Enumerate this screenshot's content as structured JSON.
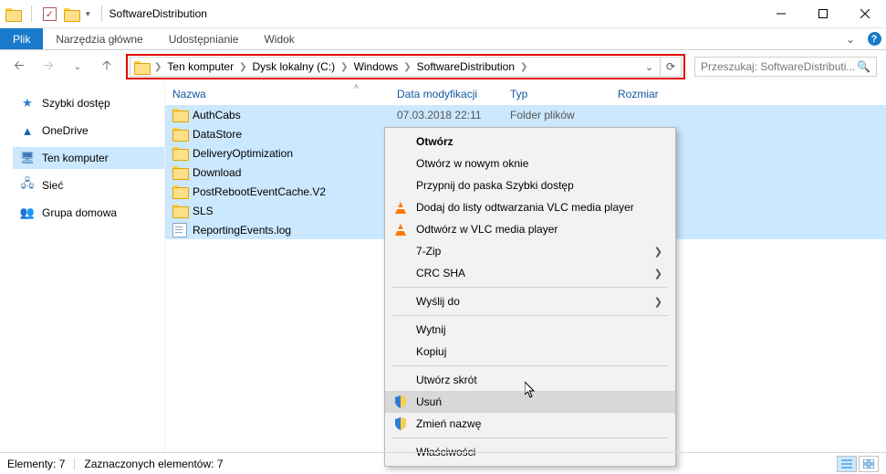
{
  "window": {
    "title": "SoftwareDistribution"
  },
  "ribbon": {
    "file": "Plik",
    "tabs": [
      "Narzędzia główne",
      "Udostępnianie",
      "Widok"
    ]
  },
  "breadcrumb": [
    "Ten komputer",
    "Dysk lokalny (C:)",
    "Windows",
    "SoftwareDistribution"
  ],
  "search": {
    "placeholder": "Przeszukaj: SoftwareDistributi..."
  },
  "navpane": {
    "items": [
      {
        "label": "Szybki dostęp",
        "icon": "star"
      },
      {
        "label": "OneDrive",
        "icon": "cloud"
      },
      {
        "label": "Ten komputer",
        "icon": "monitor",
        "selected": true
      },
      {
        "label": "Sieć",
        "icon": "net"
      },
      {
        "label": "Grupa domowa",
        "icon": "group"
      }
    ]
  },
  "columns": {
    "name": "Nazwa",
    "date": "Data modyfikacji",
    "type": "Typ",
    "size": "Rozmiar"
  },
  "rows": [
    {
      "name": "AuthCabs",
      "date": "07.03.2018 22:11",
      "type": "Folder plików",
      "kind": "folder",
      "selected": true
    },
    {
      "name": "DataStore",
      "date": "",
      "type": "",
      "kind": "folder",
      "selected": true
    },
    {
      "name": "DeliveryOptimization",
      "date": "",
      "type": "",
      "kind": "folder",
      "selected": true
    },
    {
      "name": "Download",
      "date": "",
      "type": "",
      "kind": "folder",
      "selected": true
    },
    {
      "name": "PostRebootEventCache.V2",
      "date": "",
      "type": "",
      "kind": "folder",
      "selected": true
    },
    {
      "name": "SLS",
      "date": "",
      "type": "",
      "kind": "folder",
      "selected": true
    },
    {
      "name": "ReportingEvents.log",
      "date": "",
      "type": "",
      "kind": "file",
      "selected": true
    }
  ],
  "context_menu": [
    {
      "label": "Otwórz",
      "bold": true
    },
    {
      "label": "Otwórz w nowym oknie"
    },
    {
      "label": "Przypnij do paska Szybki dostęp"
    },
    {
      "label": "Dodaj do listy odtwarzania VLC media player",
      "icon": "vlc"
    },
    {
      "label": "Odtwórz w VLC media player",
      "icon": "vlc"
    },
    {
      "label": "7-Zip",
      "submenu": true
    },
    {
      "label": "CRC SHA",
      "submenu": true
    },
    {
      "sep": true
    },
    {
      "label": "Wyślij do",
      "submenu": true
    },
    {
      "sep": true
    },
    {
      "label": "Wytnij"
    },
    {
      "label": "Kopiuj"
    },
    {
      "sep": true
    },
    {
      "label": "Utwórz skrót"
    },
    {
      "label": "Usuń",
      "icon": "shield",
      "hover": true
    },
    {
      "label": "Zmień nazwę",
      "icon": "shield"
    },
    {
      "sep": true
    },
    {
      "label": "Właściwości"
    }
  ],
  "status": {
    "items_label": "Elementy:",
    "items_count": "7",
    "selected_label": "Zaznaczonych elementów:",
    "selected_count": "7"
  }
}
